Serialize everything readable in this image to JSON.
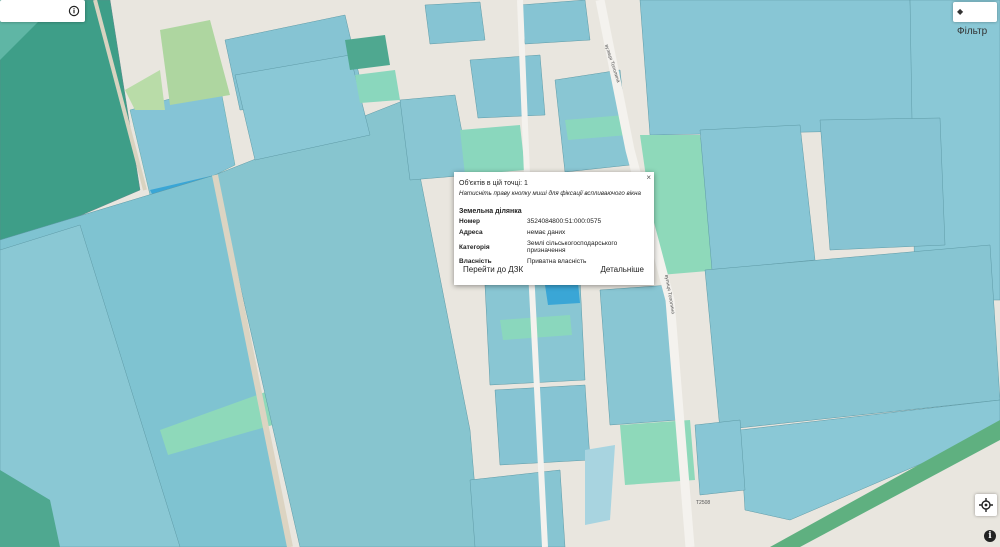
{
  "search": {
    "placeholder": "",
    "value": ""
  },
  "toolbar": {
    "info_icon": "info-circle-icon",
    "filter_label": "Фільтр",
    "filter_icon": "layers-icon"
  },
  "map": {
    "road_label_1": "вулиця Тополина",
    "road_label_2": "вулиця Тополина",
    "road_code": "Т2508"
  },
  "popup": {
    "close": "×",
    "count_text": "Об'єктів в цій точці: 1",
    "hint": "Натисніть праву кнопку миші для фіксації вспливаючого вікна",
    "section_title": "Земельна ділянка",
    "rows": [
      {
        "key": "Номер",
        "value": "3524084800:51:000:0575"
      },
      {
        "key": "Адреса",
        "value": "немає даних"
      },
      {
        "key": "Категорія",
        "value": "Землі сільськогосподарського призначення"
      },
      {
        "key": "Власність",
        "value": "Приватна власність"
      }
    ],
    "goto_link": "Перейти до ДЗК",
    "details_link": "Детальніше"
  },
  "controls": {
    "locate_icon": "crosshair-icon",
    "about_text": "i"
  },
  "colors": {
    "parcel_blue": "#88c8d6",
    "parcel_green": "#7dd6b8",
    "parcel_dark": "#4fa890",
    "selected": "#3aa6d6",
    "background": "#e9e6df"
  }
}
